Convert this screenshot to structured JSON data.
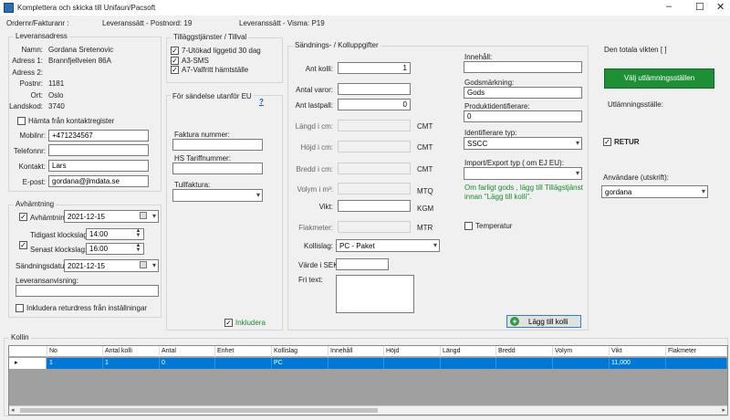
{
  "window": {
    "title": "Komplettera och skicka till Unifaun/Pacsoft"
  },
  "header": {
    "ordernr_label": "Ordernr/Fakturanr :",
    "leveranssatt_postnord": "Leveranssätt - Postnord: 19",
    "leveranssatt_visma": "Leveranssätt - Visma:   P19"
  },
  "address": {
    "title": "Leveransadress",
    "namn_label": "Namn:",
    "namn": "Gordana Sretenovic",
    "adress1_label": "Adress 1:",
    "adress1": "Brannfjellveien 86A",
    "adress2_label": "Adress 2:",
    "adress2": "",
    "postnr_label": "Postnr:",
    "postnr": "1181",
    "ort_label": "Ort:",
    "ort": "Oslo",
    "landskod_label": "Landskod:",
    "landskod": "3740",
    "hamta_label": "Hämta från kontaktregister",
    "mobilnr_label": "Mobilnr:",
    "mobilnr": "+471234567",
    "telefonnr_label": "Telefonnr:",
    "telefonnr": "",
    "kontakt_label": "Kontakt:",
    "kontakt": "Lars",
    "epost_label": "E-post:",
    "epost": "gordana@jlmdata.se"
  },
  "avhamtning": {
    "title": "Avhämtning",
    "avhamtning_label": "Avhämtning:",
    "avhamtning_date": "2021-12-15",
    "tidigast_label": "Tidigast klockslag:",
    "tidigast": "14:00",
    "senast_label": "Senast klockslag:",
    "senast": "16:00",
    "sandningsdatum_label": "Sändningsdatum:",
    "sandningsdatum": "2021-12-15",
    "leveransanvisning_label": "Leveransanvisning:",
    "leveransanvisning": "",
    "returdress_label": "Inkludera returdress från inställningar"
  },
  "tillagg": {
    "title": "Tilläggstjänster / Tillval",
    "items": [
      "7-Utökad liggetid 30 dag",
      "A3-SMS",
      "A7-Valfritt hämtställe"
    ]
  },
  "eu": {
    "title": "För sändelse utanför EU",
    "help": "?",
    "faktura_label": "Faktura nummer:",
    "faktura": "",
    "hs_label": "HS Tariffnummer:",
    "hs": "",
    "tullfaktura_label": "Tullfaktura:",
    "tullfaktura": "",
    "inkludera_label": "Inkludera"
  },
  "sandning": {
    "title": "Sändnings- / Kolluppgifter",
    "ant_kolli_label": "Ant kolli:",
    "ant_kolli": "1",
    "antal_varor_label": "Antal varor:",
    "antal_varor": "",
    "ant_lastpall_label": "Ant lastpall:",
    "ant_lastpall": "0",
    "langd_label": "Längd i cm:",
    "langd_unit": "CMT",
    "hojd_label": "Höjd i cm:",
    "hojd_unit": "CMT",
    "bredd_label": "Bredd i cm:",
    "bredd_unit": "CMT",
    "volym_label": "Volym i m³:",
    "volym_unit": "MTQ",
    "vikt_label": "Vikt:",
    "vikt_unit": "KGM",
    "flakmeter_label": "Flakmeter:",
    "flakmeter_unit": "MTR",
    "kollislag_label": "Kollislag:",
    "kollislag": "PC - Paket",
    "varde_label": "Värde i SEK:",
    "varde": "",
    "fritext_label": "Fri text:",
    "fritext": "",
    "innehall_label": "Innehåll:",
    "innehall": "",
    "godsmarkning_label": "Godsmärkning:",
    "godsmarkning": "Gods",
    "produktid_label": "Produktidentifierare:",
    "produktid": "0",
    "identifierare_label": "Identifierare typ:",
    "identifierare": "SSCC",
    "importexport_label": "Import/Export typ ( om EJ EU):",
    "importexport": "",
    "farligt_note": "Om farligt gods , lägg till Tillägstjänst innan \"Lägg till kolli\".",
    "temperatur_label": "Temperatur",
    "lagg_till_label": "Lägg till kolli"
  },
  "right": {
    "totalvikt": "Den totala vikten [ ]",
    "valj_button": "Välj utlämningsställen",
    "utlamning_label": "Utlämningsställe:",
    "retur_label": "RETUR",
    "anvandare_label": "Användare (utskrift):",
    "anvandare": "gordana"
  },
  "kolli": {
    "title": "Kollin",
    "columns": [
      "No",
      "Antal kolli",
      "Antal",
      "Enhet",
      "Kollislag",
      "Innehåll",
      "Höjd",
      "Längd",
      "Bredd",
      "Volym",
      "Vikt",
      "Flakmeter"
    ],
    "rows": [
      [
        "1",
        "1",
        "0",
        "",
        "PC",
        "",
        "",
        "",
        "",
        "",
        "11,000",
        ""
      ]
    ]
  },
  "colors": {
    "accent_green": "#1f8f36",
    "selection_blue": "#0078d7",
    "note_green": "#1a8a2a"
  }
}
